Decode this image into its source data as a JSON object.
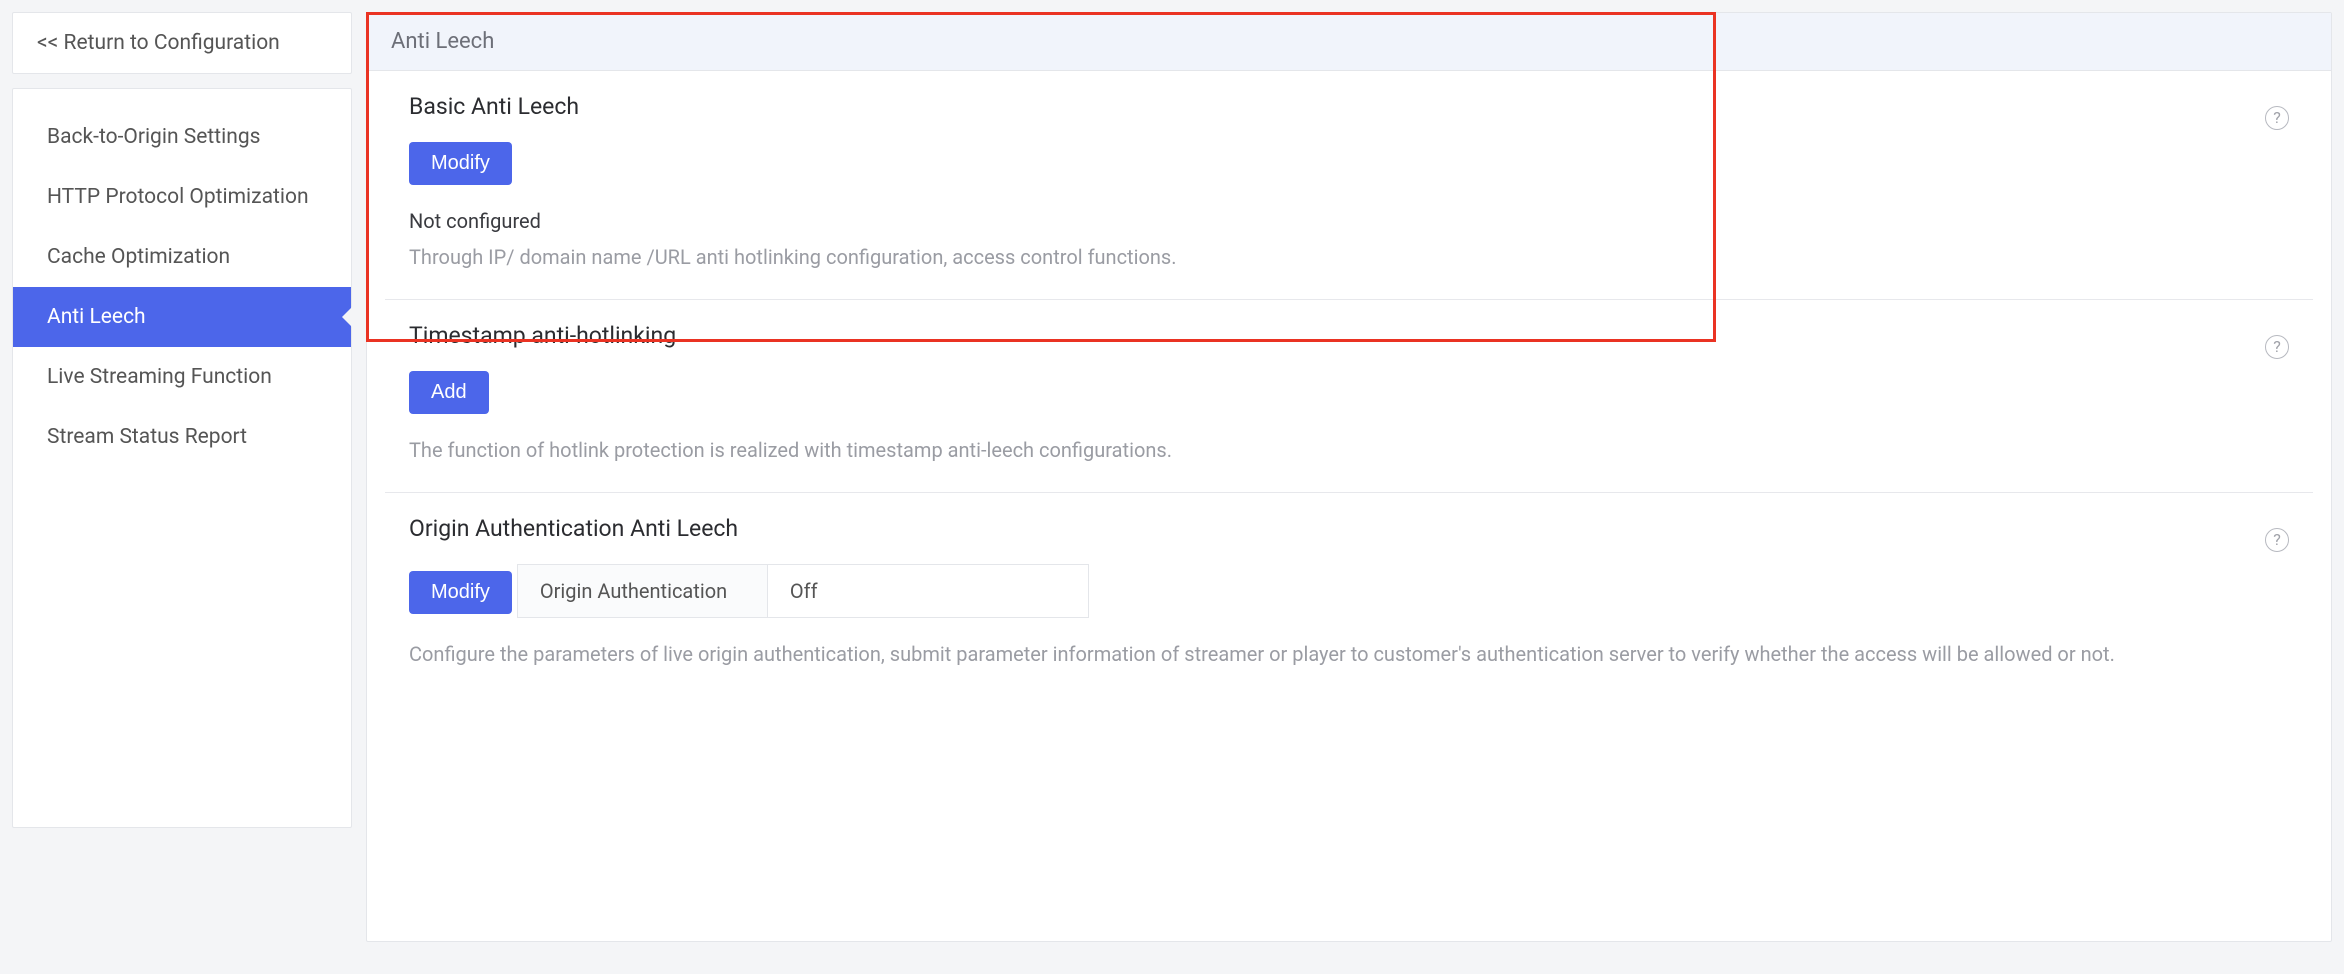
{
  "sidebar": {
    "return_label": "<<  Return to Configuration",
    "items": [
      {
        "label": "Back-to-Origin Settings"
      },
      {
        "label": "HTTP Protocol Optimization"
      },
      {
        "label": "Cache Optimization"
      },
      {
        "label": "Anti Leech"
      },
      {
        "label": "Live Streaming Function"
      },
      {
        "label": "Stream Status Report"
      }
    ],
    "active_index": 3
  },
  "page": {
    "title": "Anti Leech"
  },
  "sections": {
    "basic": {
      "title": "Basic Anti Leech",
      "button": "Modify",
      "status": "Not configured",
      "desc": "Through IP/ domain name /URL anti hotlinking configuration, access control functions."
    },
    "timestamp": {
      "title": "Timestamp anti-hotlinking",
      "button": "Add",
      "desc": "The function of hotlink protection is realized with timestamp anti-leech configurations."
    },
    "originauth": {
      "title": "Origin Authentication Anti Leech",
      "button": "Modify",
      "kv": {
        "key": "Origin Authentication",
        "value": "Off"
      },
      "desc": "Configure the parameters of live origin authentication, submit parameter information of streamer or player to customer's authentication server to verify whether the access will be allowed or not."
    }
  }
}
